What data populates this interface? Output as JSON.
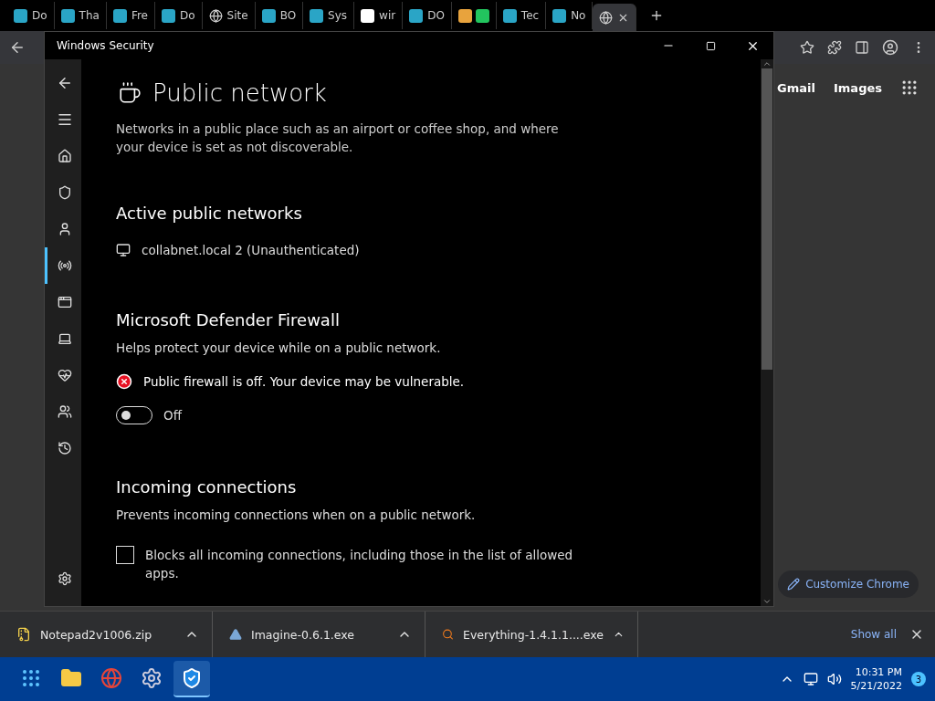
{
  "browser": {
    "tabs": [
      {
        "label": "Do",
        "selected": false,
        "kind": "page"
      },
      {
        "label": "Tha",
        "selected": false,
        "kind": "page"
      },
      {
        "label": "Fre",
        "selected": false,
        "kind": "page"
      },
      {
        "label": "Do",
        "selected": false,
        "kind": "page"
      },
      {
        "label": "Site",
        "selected": false,
        "kind": "globe"
      },
      {
        "label": "BO",
        "selected": false,
        "kind": "page"
      },
      {
        "label": "Sys",
        "selected": false,
        "kind": "page"
      },
      {
        "label": "wir",
        "selected": false,
        "kind": "google"
      },
      {
        "label": "DO",
        "selected": false,
        "kind": "page"
      },
      {
        "selected": false,
        "kind": "double"
      },
      {
        "label": "Tec",
        "selected": false,
        "kind": "page"
      },
      {
        "label": "No",
        "selected": false,
        "kind": "page"
      },
      {
        "selected": true,
        "kind": "chrome"
      }
    ],
    "links": [
      "Gmail",
      "Images"
    ],
    "customize_button": "Customize Chrome"
  },
  "window": {
    "title": "Windows Security",
    "nav": [
      {
        "kind": "home",
        "selected": false
      },
      {
        "kind": "shield",
        "selected": false
      },
      {
        "kind": "account",
        "selected": false
      },
      {
        "kind": "network",
        "selected": true
      },
      {
        "kind": "app",
        "selected": false
      },
      {
        "kind": "device",
        "selected": false
      },
      {
        "kind": "health",
        "selected": false
      },
      {
        "kind": "family",
        "selected": false
      },
      {
        "kind": "history",
        "selected": false
      }
    ],
    "page": {
      "title": "Public network",
      "description": "Networks in a public place such as an airport or coffee shop, and where your device is set as not discoverable.",
      "networks_heading": "Active public networks",
      "networks": [
        "collabnet.local 2 (Unauthenticated)"
      ],
      "firewall": {
        "heading": "Microsoft Defender Firewall",
        "description": "Helps protect your device while on a public network.",
        "warning": "Public firewall is off. Your device may be vulnerable.",
        "on": false,
        "state_label": "Off"
      },
      "incoming": {
        "heading": "Incoming connections",
        "description": "Prevents incoming connections when on a public network.",
        "checkbox_label": "Blocks all incoming connections, including those in the list of allowed apps.",
        "checked": false
      }
    }
  },
  "downloads": {
    "items": [
      {
        "name": "Notepad2v1006.zip",
        "kind": "zip"
      },
      {
        "name": "Imagine-0.6.1.exe",
        "kind": "imagine"
      },
      {
        "name": "Everything-1.4.1.1....exe",
        "kind": "search"
      }
    ],
    "show_all": "Show all"
  },
  "taskbar": {
    "apps": [
      {
        "kind": "start",
        "selected": false
      },
      {
        "kind": "explorer",
        "selected": false
      },
      {
        "kind": "chrome",
        "selected": false
      },
      {
        "kind": "settings",
        "selected": false
      },
      {
        "kind": "security",
        "selected": true
      }
    ],
    "time": "10:31 PM",
    "date": "5/21/2022",
    "notifications": "3"
  }
}
